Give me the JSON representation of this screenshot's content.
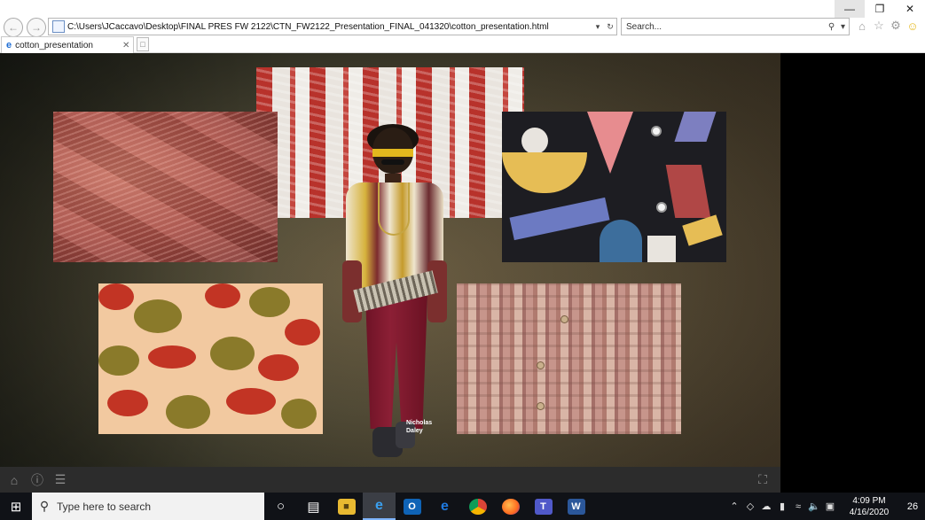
{
  "browser": {
    "address_url": "C:\\Users\\JCaccavo\\Desktop\\FINAL PRES FW 2122\\CTN_FW2122_Presentation_FINAL_041320\\cotton_presentation.html",
    "search_placeholder": "Search...",
    "tab_title": "cotton_presentation",
    "icons": [
      "back-icon",
      "forward-icon",
      "page-icon",
      "dropdown-icon",
      "refresh-icon",
      "search-icon",
      "home-icon",
      "favorites-icon",
      "settings-icon",
      "smiley-icon",
      "close-icon",
      "new-tab-icon"
    ],
    "window_controls": {
      "minimize": "—",
      "restore": "❐",
      "close": "✕"
    }
  },
  "presentation": {
    "caption_line1": "Nicholas",
    "caption_line2": "Daley",
    "colors": {
      "accent_yellow": "#e3b81e",
      "burgundy": "#8c1f35",
      "brick_red": "#b8322b"
    },
    "bar_icons": [
      "home-icon",
      "info-icon",
      "menu-icon",
      "fullscreen-icon"
    ]
  },
  "taskbar": {
    "search_placeholder": "Type here to search",
    "apps": [
      "cortana-icon",
      "task-view-icon",
      "file-explorer-icon",
      "internet-explorer-icon",
      "outlook-icon",
      "edge-icon",
      "chrome-icon",
      "firefox-icon",
      "teams-icon",
      "word-icon"
    ],
    "clock_time": "4:09 PM",
    "clock_date": "4/16/2020",
    "notification_count": "26"
  }
}
